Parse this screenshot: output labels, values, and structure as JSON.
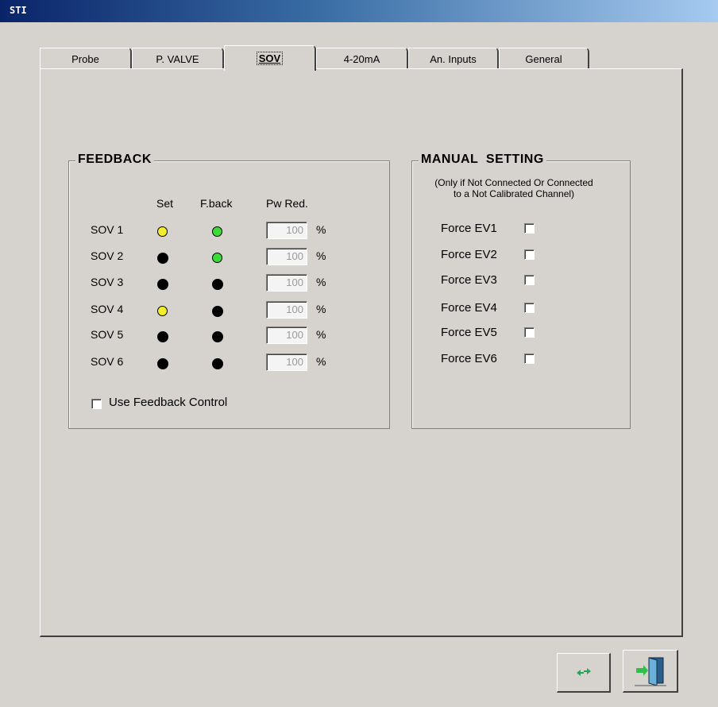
{
  "window": {
    "title": "STI"
  },
  "tabs": [
    {
      "label": "Probe"
    },
    {
      "label": "P. VALVE"
    },
    {
      "label": "SOV"
    },
    {
      "label": "4-20mA"
    },
    {
      "label": "An. Inputs"
    },
    {
      "label": "General"
    }
  ],
  "feedback": {
    "title": "FEEDBACK",
    "col_set": "Set",
    "col_fback": "F.back",
    "col_pw": "Pw Red.",
    "unit": "%",
    "rows": [
      {
        "label": "SOV 1",
        "set": "yellow",
        "fback": "green",
        "pw": "100"
      },
      {
        "label": "SOV 2",
        "set": "black",
        "fback": "green",
        "pw": "100"
      },
      {
        "label": "SOV 3",
        "set": "black",
        "fback": "black",
        "pw": "100"
      },
      {
        "label": "SOV 4",
        "set": "yellow",
        "fback": "black",
        "pw": "100"
      },
      {
        "label": "SOV 5",
        "set": "black",
        "fback": "black",
        "pw": "100"
      },
      {
        "label": "SOV 6",
        "set": "black",
        "fback": "black",
        "pw": "100"
      }
    ],
    "use_feedback_label": "Use Feedback Control"
  },
  "manual": {
    "title": "MANUAL  SETTING",
    "note_line1": "(Only if Not Connected Or Connected",
    "note_line2": "to a Not Calibrated Channel)",
    "items": [
      {
        "label": "Force EV1"
      },
      {
        "label": "Force EV2"
      },
      {
        "label": "Force EV3"
      },
      {
        "label": "Force EV4"
      },
      {
        "label": "Force EV5"
      },
      {
        "label": "Force EV6"
      }
    ]
  },
  "colors": {
    "yellow": "#f2ee2c",
    "green": "#3ddb3a",
    "black": "#000000",
    "titlebar": "#0a246a"
  },
  "buttons": {
    "refresh_icon": "refresh-icon",
    "exit_icon": "exit-door-icon"
  }
}
